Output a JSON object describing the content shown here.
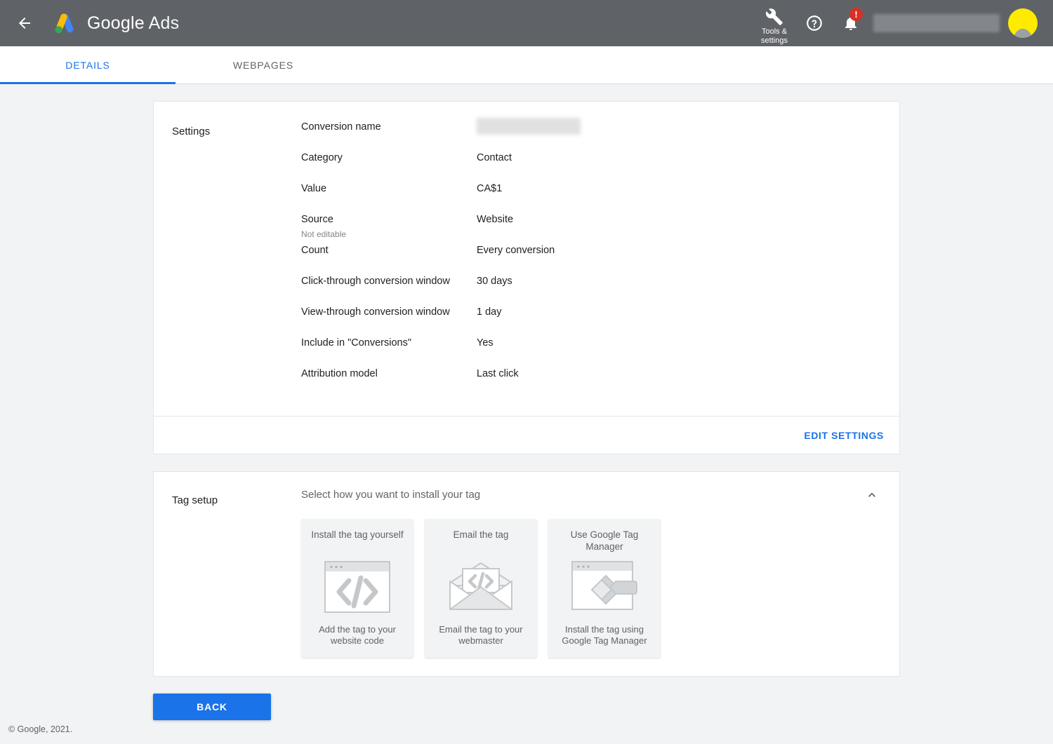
{
  "header": {
    "back_icon": "arrow-left-icon",
    "brand_google": "Google",
    "brand_ads": "Ads",
    "tools_label_line1": "Tools &",
    "tools_label_line2": "settings",
    "tools_icon": "wrench-icon",
    "help_icon": "help-circle-icon",
    "notifications_icon": "bell-icon",
    "notification_badge": "!",
    "avatar_icon": "account-avatar",
    "account_redacted": "",
    "bg_color": "#5f6368",
    "badge_color": "#d93025",
    "avatar_color": "#ffeb00"
  },
  "tabs": [
    {
      "label": "DETAILS",
      "active": true
    },
    {
      "label": "WEBPAGES",
      "active": false
    }
  ],
  "settings_card": {
    "section_label": "Settings",
    "rows": [
      {
        "key": "Conversion name",
        "sub": "",
        "value": "",
        "redacted": true
      },
      {
        "key": "Category",
        "sub": "",
        "value": "Contact",
        "redacted": false
      },
      {
        "key": "Value",
        "sub": "",
        "value": "CA$1",
        "redacted": false
      },
      {
        "key": "Source",
        "sub": "Not editable",
        "value": "Website",
        "redacted": false
      },
      {
        "key": "Count",
        "sub": "",
        "value": "Every conversion",
        "redacted": false
      },
      {
        "key": "Click-through conversion window",
        "sub": "",
        "value": "30 days",
        "redacted": false
      },
      {
        "key": "View-through conversion window",
        "sub": "",
        "value": "1 day",
        "redacted": false
      },
      {
        "key": "Include in \"Conversions\"",
        "sub": "",
        "value": "Yes",
        "redacted": false
      },
      {
        "key": "Attribution model",
        "sub": "",
        "value": "Last click",
        "redacted": false
      }
    ],
    "edit_link": "EDIT SETTINGS"
  },
  "tag_setup_card": {
    "section_label": "Tag setup",
    "subtitle": "Select how you want to install your tag",
    "collapse_icon": "chevron-up-icon",
    "tiles": [
      {
        "title": "Install the tag yourself",
        "description": "Add the tag to your website code",
        "art_icon": "browser-code-icon"
      },
      {
        "title": "Email the tag",
        "description": "Email the tag to your webmaster",
        "art_icon": "envelope-code-icon"
      },
      {
        "title": "Use Google Tag Manager",
        "description": "Install the tag using Google Tag Manager",
        "art_icon": "tag-manager-icon"
      }
    ]
  },
  "actions": {
    "back_label": "BACK",
    "primary_color": "#1a73e8"
  },
  "footer": {
    "copyright": "© Google, 2021."
  }
}
